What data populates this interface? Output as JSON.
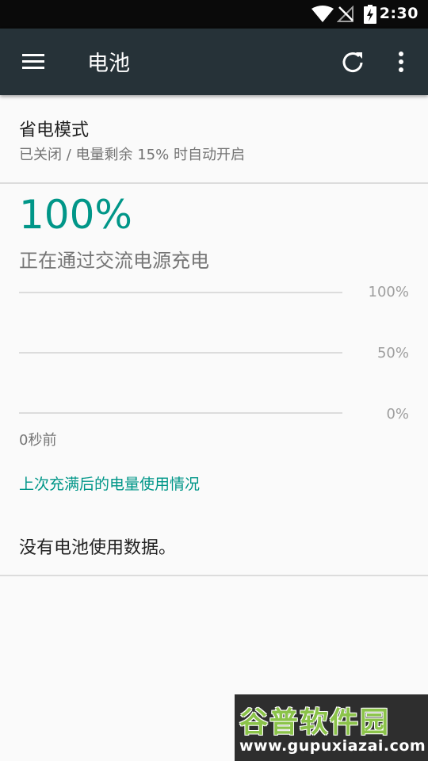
{
  "status_bar": {
    "time": "2:30",
    "icons": [
      "wifi-icon",
      "no-signal-icon",
      "battery-charging-icon"
    ]
  },
  "toolbar": {
    "title": "电池",
    "icons": [
      "menu-icon",
      "refresh-icon",
      "more-vert-icon"
    ]
  },
  "battery_saver": {
    "title": "省电模式",
    "summary": "已关闭 / 电量剩余 15% 时自动开启"
  },
  "battery": {
    "level": "100%",
    "status": "正在通过交流电源充电"
  },
  "chart": {
    "label_100": "100%",
    "label_50": "50%",
    "label_0": "0%",
    "time_label": "0秒前"
  },
  "history_link": "上次充满后的电量使用情况",
  "empty_message": "没有电池使用数据。",
  "watermark": {
    "logo": "谷普软件园",
    "url": "www.gupuxiazai.com"
  },
  "colors": {
    "accent": "#009688",
    "toolbar": "#263238",
    "status_bar": "#0a0a0a"
  }
}
